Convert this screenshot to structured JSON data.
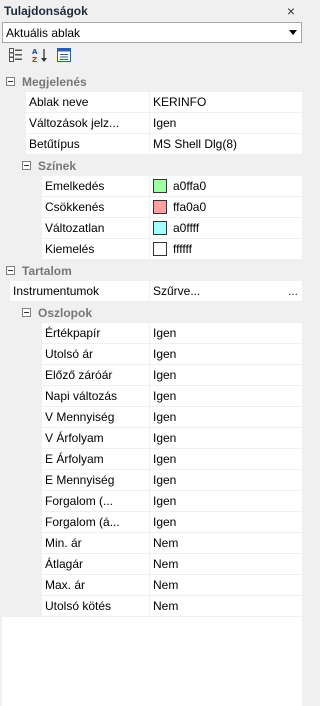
{
  "panel": {
    "title": "Tulajdonságok",
    "close_glyph": "×"
  },
  "combo": {
    "value": "Aktuális ablak"
  },
  "toolbar": {
    "icons": [
      "categorized-icon",
      "alphabetical-icon",
      "property-pages-icon"
    ]
  },
  "sections": {
    "megjelenes": {
      "label": "Megjelenés",
      "rows": [
        {
          "name": "Ablak neve",
          "value": "KERINFO"
        },
        {
          "name": "Változások jelz...",
          "value": "Igen"
        },
        {
          "name": "Betűtípus",
          "value": "MS Shell Dlg(8)"
        }
      ],
      "szinek": {
        "label": "Színek",
        "rows": [
          {
            "name": "Emelkedés",
            "value": "a0ffa0",
            "color": "#a0ffa0"
          },
          {
            "name": "Csökkenés",
            "value": "ffa0a0",
            "color": "#ffa0a0"
          },
          {
            "name": "Változatlan",
            "value": "a0ffff",
            "color": "#a0ffff"
          },
          {
            "name": "Kiemelés",
            "value": "ffffff",
            "color": "#ffffff"
          }
        ]
      }
    },
    "tartalom": {
      "label": "Tartalom",
      "instrumentumok": {
        "name": "Instrumentumok",
        "value": "Szűrve...",
        "button": "..."
      },
      "oszlopok": {
        "label": "Oszlopok",
        "rows": [
          {
            "name": "Értékpapír",
            "value": "Igen"
          },
          {
            "name": "Utolsó ár",
            "value": "Igen"
          },
          {
            "name": "Előző záróár",
            "value": "Igen"
          },
          {
            "name": "Napi változás",
            "value": "Igen"
          },
          {
            "name": "V Mennyiség",
            "value": "Igen"
          },
          {
            "name": "V Árfolyam",
            "value": "Igen"
          },
          {
            "name": "E Árfolyam",
            "value": "Igen"
          },
          {
            "name": "E Mennyiség",
            "value": "Igen"
          },
          {
            "name": "Forgalom (...",
            "value": "Igen"
          },
          {
            "name": "Forgalom (á...",
            "value": "Igen"
          },
          {
            "name": "Min. ár",
            "value": "Nem"
          },
          {
            "name": "Átlagár",
            "value": "Nem"
          },
          {
            "name": "Max. ár",
            "value": "Nem"
          },
          {
            "name": "Utolsó kötés",
            "value": "Nem"
          }
        ]
      }
    }
  }
}
